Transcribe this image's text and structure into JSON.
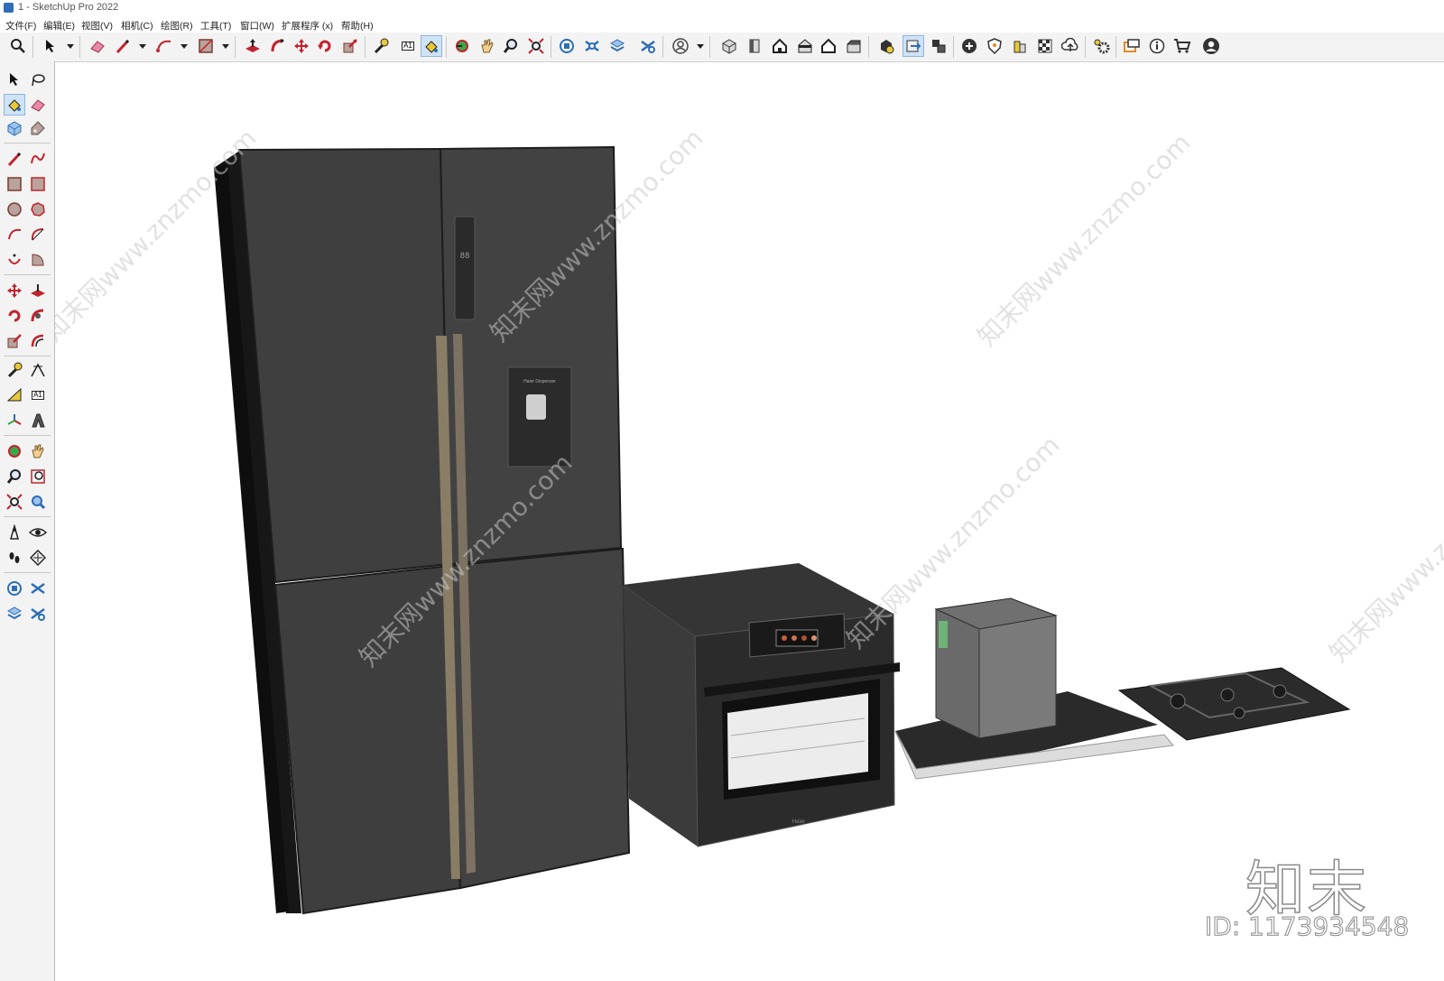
{
  "window": {
    "title": "1 - SketchUp Pro 2022"
  },
  "menu": {
    "items": [
      "文件(F)",
      "编辑(E)",
      "视图(V)",
      "相机(C)",
      "绘图(R)",
      "工具(T)",
      "窗口(W)",
      "扩展程序 (x)",
      "帮助(H)"
    ]
  },
  "toolbar": {
    "text_tool_glyph": "A1"
  },
  "sidebar": {
    "text_tool_glyph": "A1"
  },
  "watermark": {
    "url_text": "知末网www.znzmo.com",
    "logo_text": "知末",
    "id_text": "ID: 1173934548"
  },
  "scene": {
    "dispenser_label": "Haier Dispenser",
    "fridge_display_readout": "88",
    "oven_brand": "Haier"
  },
  "colors": {
    "fridge_body": "#3f3f3f",
    "fridge_side": "#171717",
    "fridge_handle": "#8a7d66",
    "oven_body": "#3a3a3a",
    "hood_canopy": "#6a6a6a",
    "hood_base": "#2a2a2a",
    "cooktop": "#2b2b2b",
    "toolbar_bg": "#f3f3f3"
  }
}
